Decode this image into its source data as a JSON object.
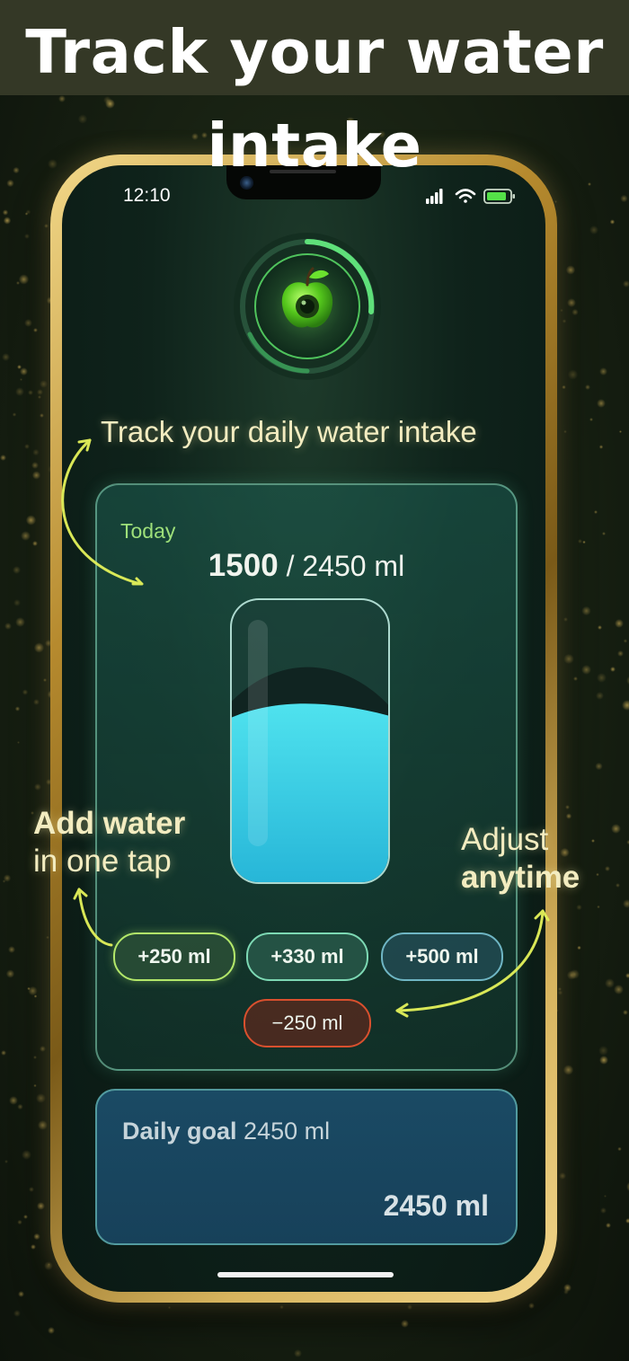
{
  "banner": {
    "headline": "Track your water intake"
  },
  "status_bar": {
    "time": "12:10",
    "icons": [
      "signal-icon",
      "wifi-icon",
      "battery-icon"
    ]
  },
  "captions": {
    "track": "Track your daily water intake",
    "add_line1": "Add water",
    "add_line2": "in one tap",
    "adjust_line1": "Adjust",
    "adjust_line2": "anytime"
  },
  "today_card": {
    "label": "Today",
    "current": "1500",
    "goal_text": " / 2450 ml",
    "fill_fraction": 0.61
  },
  "quick_add": [
    "+250 ml",
    "+330 ml",
    "+500 ml"
  ],
  "remove_button": "−250 ml",
  "goal_card": {
    "label_bold": "Daily goal",
    "label_value": " 2450 ml",
    "value": "2450 ml"
  },
  "colors": {
    "accent_green": "#9ee07a",
    "water": "#3fd4e4",
    "remove": "#d9502e"
  }
}
